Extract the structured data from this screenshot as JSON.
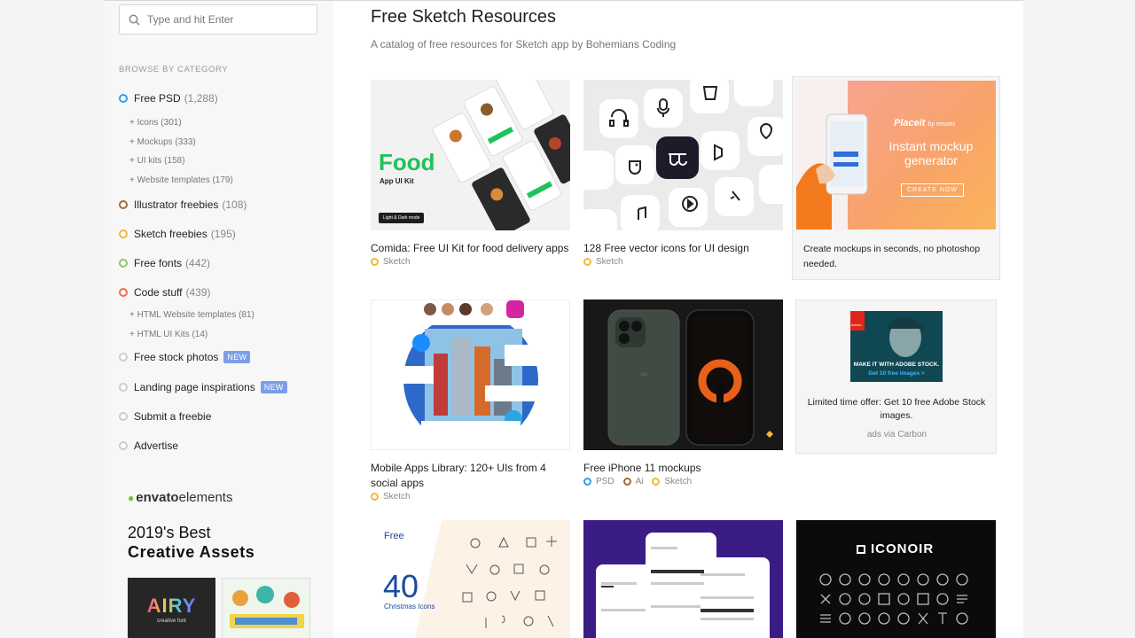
{
  "search": {
    "placeholder": "Type and hit Enter"
  },
  "sidebar": {
    "heading": "BROWSE BY CATEGORY",
    "categories": [
      {
        "label": "Free PSD",
        "count": "(1,288)",
        "color": "#2e9fe6"
      },
      {
        "label": "Illustrator freebies",
        "count": "(108)",
        "color": "#a06b3a"
      },
      {
        "label": "Sketch freebies",
        "count": "(195)",
        "color": "#f2b83a"
      },
      {
        "label": "Free fonts",
        "count": "(442)",
        "color": "#8dc46a"
      },
      {
        "label": "Code stuff",
        "count": "(439)",
        "color": "#ec6d4d"
      },
      {
        "label": "Free stock photos",
        "badge": "NEW",
        "color": "#cccccc"
      },
      {
        "label": "Landing page inspirations",
        "badge": "NEW",
        "color": "#cccccc"
      },
      {
        "label": "Submit a freebie",
        "color": "#cccccc"
      },
      {
        "label": "Advertise",
        "color": "#cccccc"
      }
    ],
    "psd_subs": [
      "+ Icons (301)",
      "+ Mockups (333)",
      "+ UI kits (158)",
      "+ Website templates (179)"
    ],
    "code_subs": [
      "+ HTML Website templates (81)",
      "+ HTML UI Kits (14)"
    ],
    "promo": {
      "brand": "envato",
      "brand2": "elements",
      "line1": "2019's Best",
      "line2": "Creative Assets",
      "airy": "AIRY",
      "airy_sub": "creative font"
    }
  },
  "main": {
    "title": "Free Sketch Resources",
    "subtitle": "A catalog of free resources for Sketch app by Bohemians Coding",
    "cards": [
      {
        "name": "Comida: Free UI Kit for food delivery apps",
        "tags": [
          "Sketch"
        ],
        "thumb_title": "Food",
        "thumb_sub": "App UI Kit",
        "thumb_btn": "Light & Dark mode"
      },
      {
        "name": "128 Free vector icons for UI design",
        "tags": [
          "Sketch"
        ]
      },
      {
        "name": "Mobile Apps Library: 120+ UIs from 4 social apps",
        "tags": [
          "Sketch"
        ]
      },
      {
        "name": "Free iPhone 11 mockups",
        "tags": [
          "PSD",
          "Ai",
          "Sketch"
        ]
      },
      {
        "name": "",
        "thumb_top": "Free",
        "thumb_num": "40",
        "thumb_sub": "Christmas Icons"
      },
      {
        "name": ""
      },
      {
        "name": "",
        "thumb_title": "ICONOIR"
      }
    ],
    "ad1": {
      "text": "Create mockups in seconds, no photoshop needed.",
      "brand": "Placeit",
      "brand_by": "by envato",
      "headline": "Instant mockup generator",
      "cta": "CREATE NOW"
    },
    "ad2": {
      "text": "Limited time offer: Get 10 free Adobe Stock images.",
      "via": "ads via Carbon",
      "banner1": "MAKE IT WITH ADOBE STOCK.",
      "banner2": "Get 10 free images >",
      "adobe": "Adobe"
    }
  }
}
